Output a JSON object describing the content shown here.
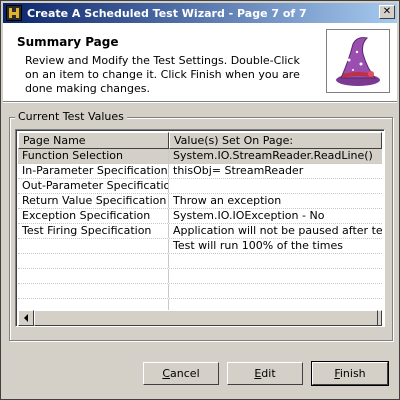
{
  "window": {
    "title": "Create A Scheduled Test Wizard - Page 7 of 7",
    "close_glyph": "✕"
  },
  "header": {
    "title": "Summary Page",
    "description": "Review and Modify the Test Settings. Double-Click on an item to change it.  Click Finish when you are done making changes.",
    "image_icon": "wizard-hat-icon"
  },
  "group": {
    "label": "Current Test Values"
  },
  "table": {
    "columns": [
      "Page Name",
      "Value(s) Set On Page:"
    ],
    "rows": [
      {
        "page": "Function Selection",
        "value": "System.IO.StreamReader.ReadLine()",
        "selected": true
      },
      {
        "page": "In-Parameter Specification",
        "value": "thisObj= StreamReader"
      },
      {
        "page": "Out-Parameter Specification",
        "value": ""
      },
      {
        "page": "Return Value Specification",
        "value": "Throw an exception"
      },
      {
        "page": "Exception Specification",
        "value": "System.IO.IOException - No"
      },
      {
        "page": "Test Firing Specification",
        "value": "Application will not be paused after test ..."
      },
      {
        "page": "",
        "value": "Test will run 100% of the times"
      },
      {
        "page": "",
        "value": ""
      },
      {
        "page": "",
        "value": ""
      },
      {
        "page": "",
        "value": ""
      },
      {
        "page": "",
        "value": ""
      }
    ]
  },
  "buttons": {
    "cancel": {
      "label": "Cancel",
      "mnemonic": "C",
      "rest": "ancel"
    },
    "edit": {
      "label": "Edit",
      "mnemonic": "E",
      "rest": "dit"
    },
    "finish": {
      "label": "Finish",
      "mnemonic": "F",
      "rest": "inish"
    }
  },
  "colors": {
    "title_start": "#0a246a",
    "title_end": "#a6caf0",
    "face": "#d4d0c8",
    "hat_purple": "#9a4fb0",
    "hat_band": "#c03040"
  }
}
